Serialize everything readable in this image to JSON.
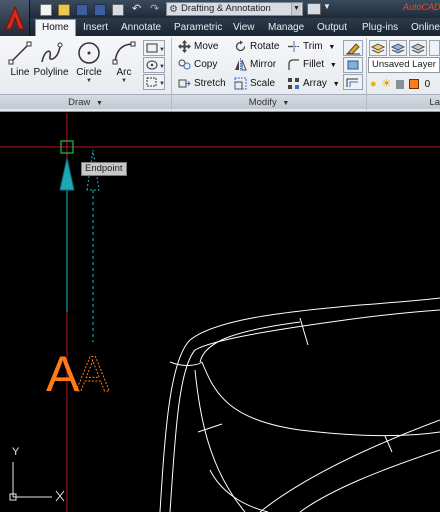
{
  "quick_access": {
    "workspace": "Drafting & Annotation",
    "title_fragment": "AutoCAD"
  },
  "tabs": [
    {
      "label": "Home",
      "active": true
    },
    {
      "label": "Insert"
    },
    {
      "label": "Annotate"
    },
    {
      "label": "Parametric"
    },
    {
      "label": "View"
    },
    {
      "label": "Manage"
    },
    {
      "label": "Output"
    },
    {
      "label": "Plug-ins"
    },
    {
      "label": "Online"
    }
  ],
  "draw_panel": {
    "title": "Draw",
    "tools": {
      "line": "Line",
      "polyline": "Polyline",
      "circle": "Circle",
      "arc": "Arc"
    }
  },
  "modify_panel": {
    "title": "Modify",
    "tools": {
      "move": "Move",
      "rotate": "Rotate",
      "trim": "Trim",
      "copy": "Copy",
      "mirror": "Mirror",
      "fillet": "Fillet",
      "stretch": "Stretch",
      "scale": "Scale",
      "array": "Array"
    }
  },
  "layers_panel": {
    "title_fragment": "La",
    "layer_state": "Unsaved Layer St",
    "current_layer": "0"
  },
  "canvas": {
    "snap_tooltip": "Endpoint",
    "drawing_text": "AA",
    "ucs_y": "Y"
  },
  "colors": {
    "accent_red": "#d42a1a",
    "crosshair": "#c0141e",
    "tracking_cyan": "#1fb7c2",
    "text_orange": "#ff7a18",
    "snap_green": "#22c24a"
  }
}
